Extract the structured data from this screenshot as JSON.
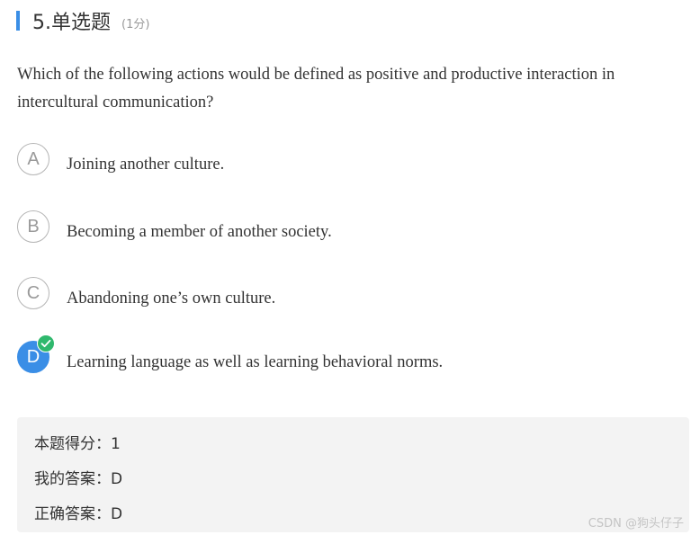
{
  "header": {
    "title": "5.单选题",
    "score": "(1分)",
    "accent_color": "#3a8ee6"
  },
  "question": {
    "text": "Which of the following actions would be defined as positive and productive interaction in intercultural communication?"
  },
  "options": [
    {
      "letter": "A",
      "text": "Joining another culture.",
      "selected": false
    },
    {
      "letter": "B",
      "text": "Becoming a member of another society.",
      "selected": false
    },
    {
      "letter": "C",
      "text": "Abandoning one’s own culture.",
      "selected": false
    },
    {
      "letter": "D",
      "text": "Learning language as well as learning behavioral norms.",
      "selected": true,
      "correct_badge": "check-icon"
    }
  ],
  "result": {
    "score_line": "本题得分：1",
    "my_answer_line": "我的答案：D",
    "correct_answer_line": "正确答案：D"
  },
  "watermark": "CSDN @狗头仔子",
  "colors": {
    "selected": "#3a8ee6",
    "correct_badge": "#2fb86d",
    "result_bg": "#f3f3f3"
  }
}
